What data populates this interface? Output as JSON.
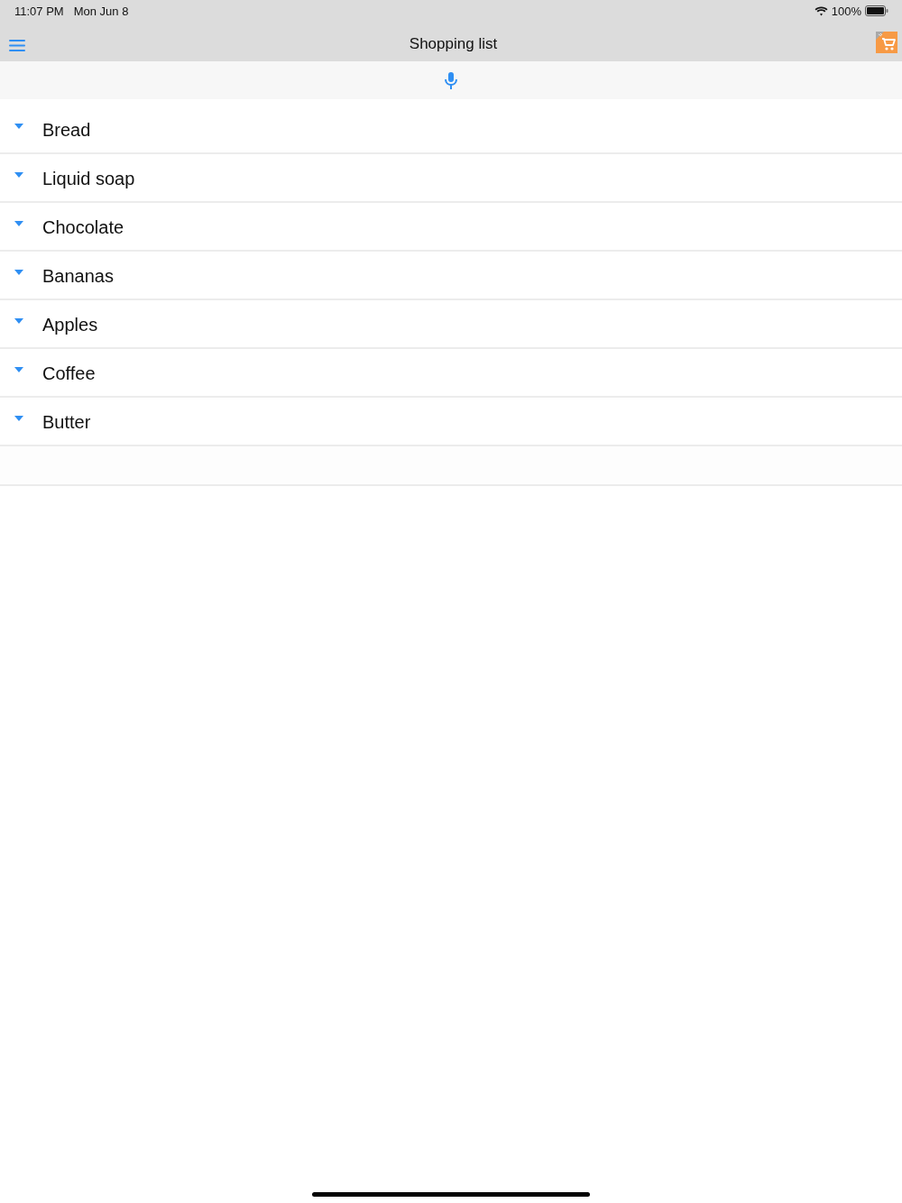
{
  "status_bar": {
    "time": "11:07 PM",
    "date": "Mon Jun 8",
    "battery": "100%"
  },
  "nav_bar": {
    "title": "Shopping list"
  },
  "items": [
    {
      "name": "Bread"
    },
    {
      "name": "Liquid soap"
    },
    {
      "name": "Chocolate"
    },
    {
      "name": "Bananas"
    },
    {
      "name": "Apples"
    },
    {
      "name": "Coffee"
    },
    {
      "name": "Butter"
    }
  ]
}
